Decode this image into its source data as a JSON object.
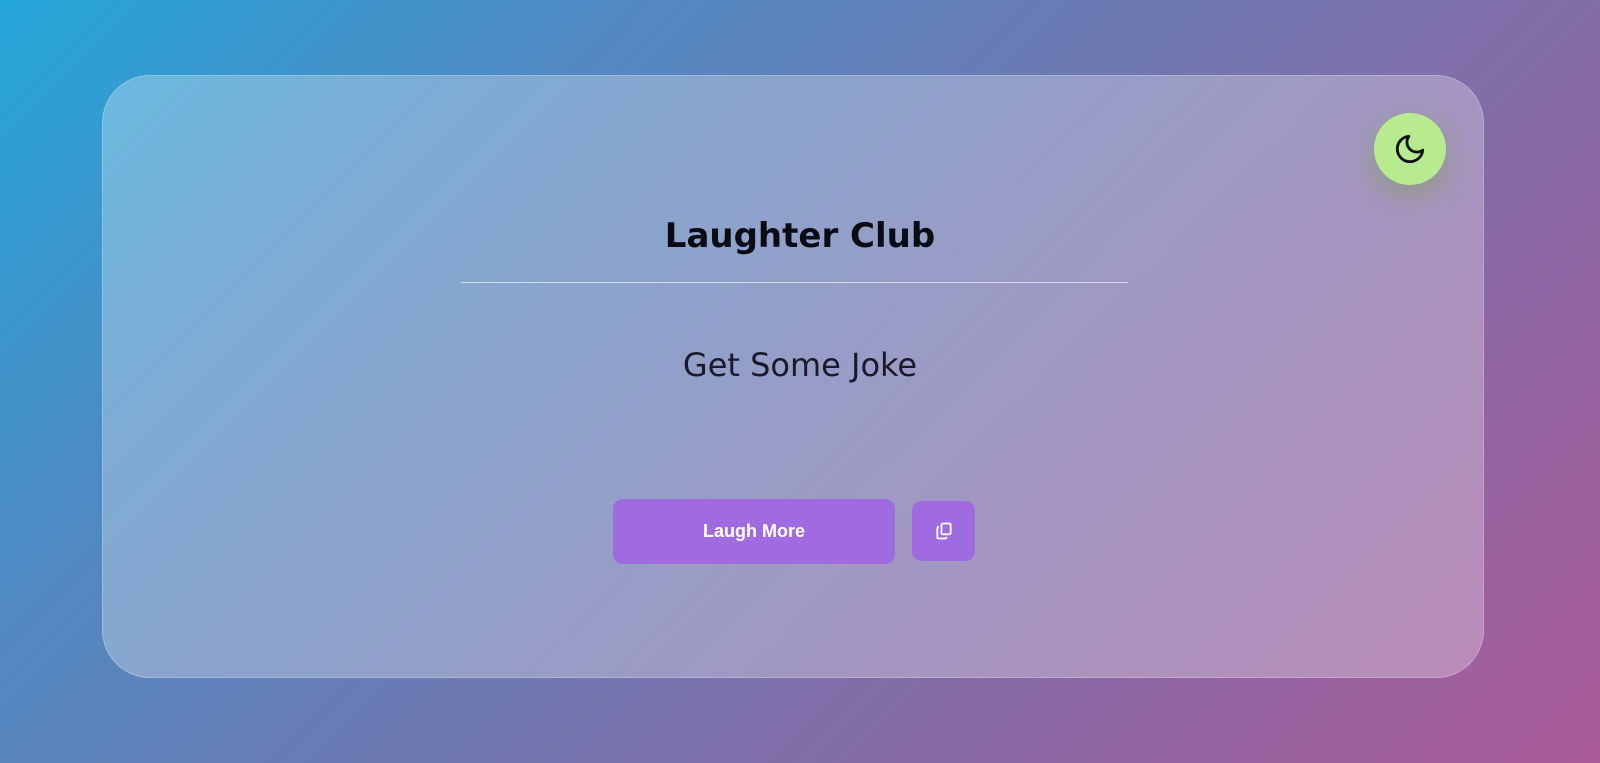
{
  "app": {
    "title": "Laughter Club"
  },
  "joke": {
    "text": "Get Some Joke"
  },
  "actions": {
    "laugh_label": "Laugh More",
    "copy_icon": "copy-icon",
    "theme_icon": "moon-icon"
  },
  "colors": {
    "accent": "#a06ae0",
    "toggle": "#b8ea90"
  }
}
